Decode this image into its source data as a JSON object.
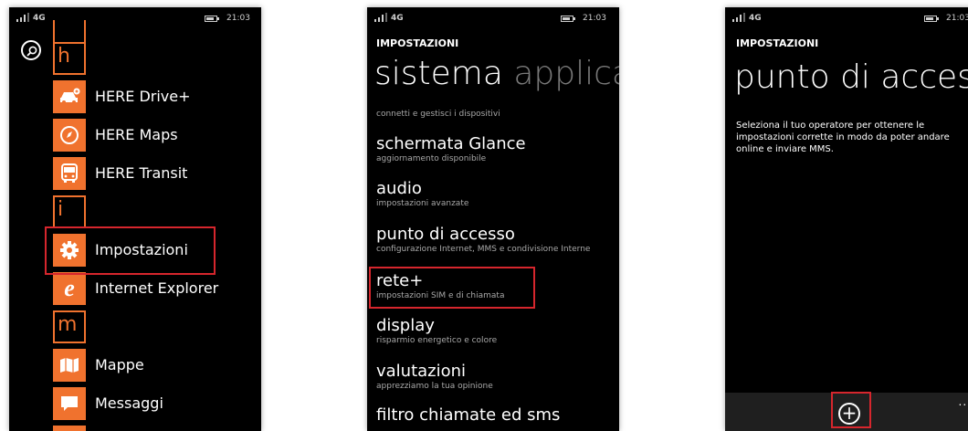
{
  "status_bar": {
    "network": "4G",
    "time": "21:03"
  },
  "screen_apps": {
    "letters": [
      "h",
      "i",
      "m"
    ],
    "apps": [
      {
        "label": "HERE Drive+",
        "icon": "car-icon"
      },
      {
        "label": "HERE Maps",
        "icon": "compass-icon"
      },
      {
        "label": "HERE Transit",
        "icon": "bus-icon"
      },
      {
        "label": "Impostazioni",
        "icon": "gear-icon"
      },
      {
        "label": "Internet Explorer",
        "icon": "internet-explorer-icon"
      },
      {
        "label": "Mappe",
        "icon": "map-icon"
      },
      {
        "label": "Messaggi",
        "icon": "message-icon"
      }
    ],
    "accent_color": "#f0722e",
    "highlight_color": "#d6262d"
  },
  "screen_settings": {
    "header": "IMPOSTAZIONI",
    "pivot_active": "sistema",
    "pivot_next": "applica",
    "top_cut_subtitle": "connetti e gestisci i dispositivi",
    "items": [
      {
        "title": "schermata Glance",
        "subtitle": "aggiornamento disponibile"
      },
      {
        "title": "audio",
        "subtitle": "impostazioni avanzate"
      },
      {
        "title": "punto di accesso",
        "subtitle": "configurazione Internet, MMS e condivisione Interne"
      },
      {
        "title": "rete+",
        "subtitle": "impostazioni SIM e di chiamata"
      },
      {
        "title": "display",
        "subtitle": "risparmio energetico e colore"
      },
      {
        "title": "valutazioni",
        "subtitle": "apprezziamo la tua opinione"
      },
      {
        "title": "filtro chiamate ed sms",
        "subtitle": ""
      }
    ]
  },
  "screen_access_point": {
    "header": "IMPOSTAZIONI",
    "title": "punto di acces",
    "description": "Seleziona il tuo operatore per ottenere le impostazioni corrette in modo da poter andare online e inviare MMS.",
    "more": "..."
  }
}
